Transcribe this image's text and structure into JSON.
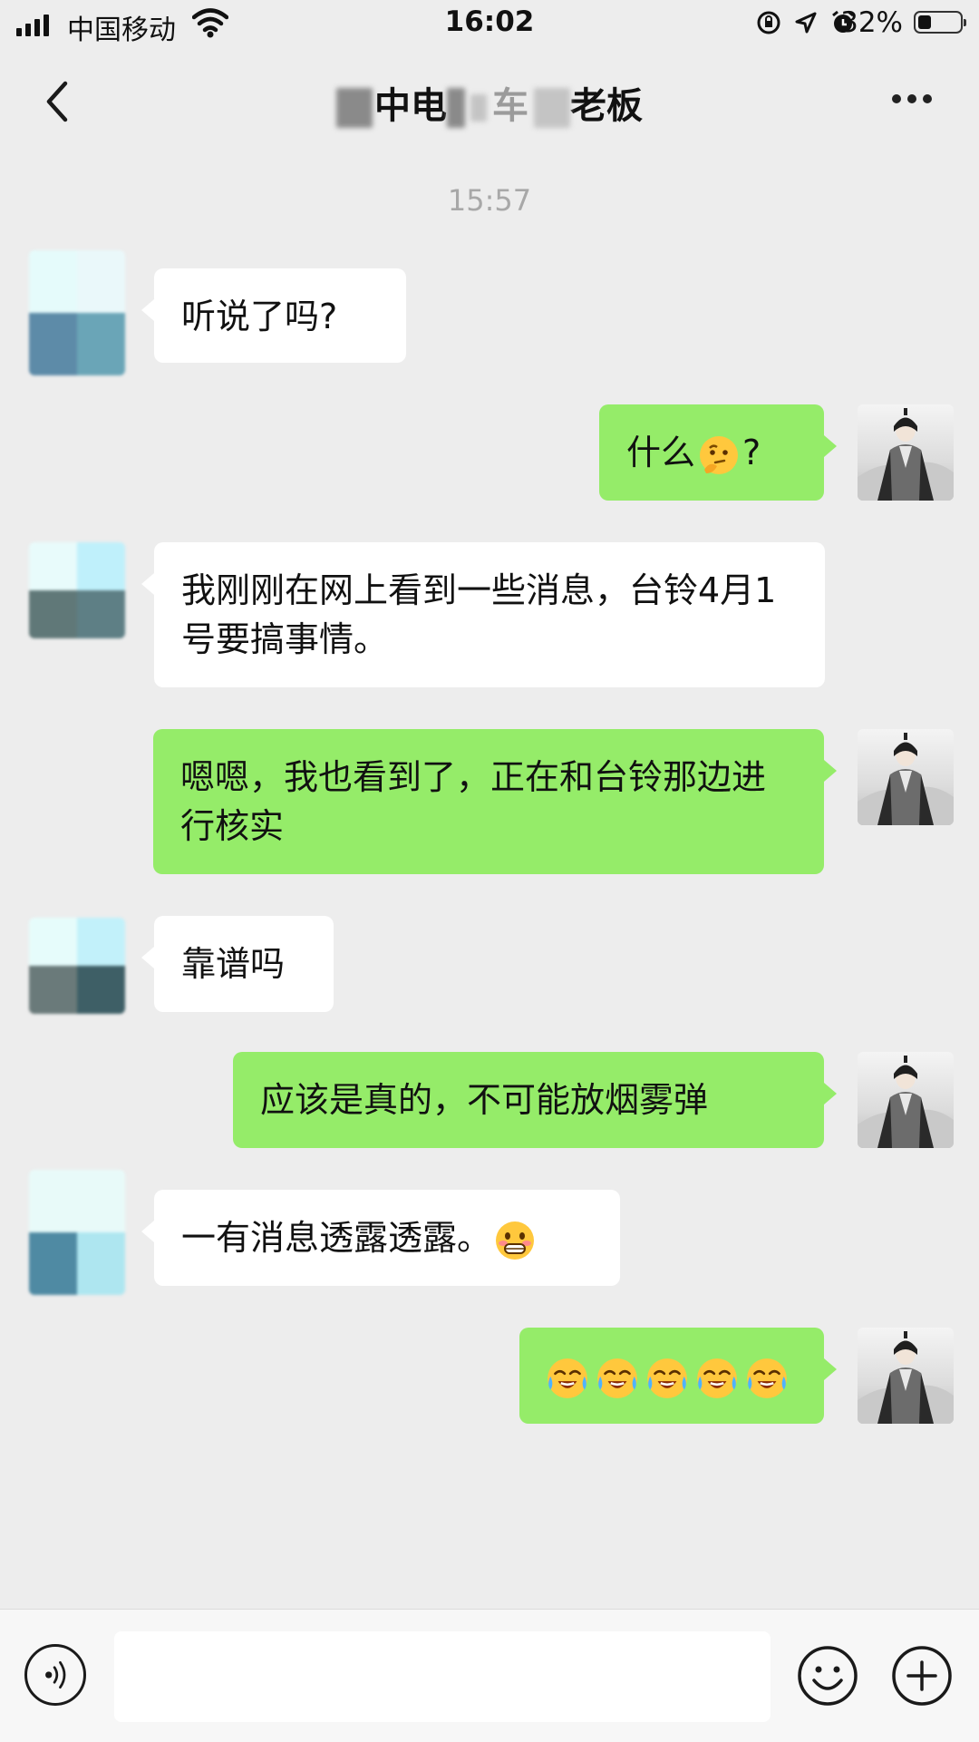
{
  "status_bar": {
    "carrier": "中国移动",
    "time": "16:02",
    "battery_percent": "32%"
  },
  "nav": {
    "title_visible_parts": [
      "中电",
      "车",
      "老板"
    ]
  },
  "chat": {
    "timestamp": "15:57",
    "messages": [
      {
        "side": "in",
        "text": "听说了吗?"
      },
      {
        "side": "out",
        "text": "什么",
        "suffix": "?",
        "emoji": "thinking-face"
      },
      {
        "side": "in",
        "text": "我刚刚在网上看到一些消息，台铃4月1号要搞事情。"
      },
      {
        "side": "out",
        "text": "嗯嗯，我也看到了，正在和台铃那边进行核实"
      },
      {
        "side": "in",
        "text": "靠谱吗"
      },
      {
        "side": "out",
        "text": "应该是真的，不可能放烟雾弹"
      },
      {
        "side": "in",
        "text": "一有消息透露透露。",
        "emoji": "grimacing-face"
      },
      {
        "side": "out",
        "emoji": "loudly-laughing-face",
        "emoji_count": 5
      }
    ]
  },
  "colors": {
    "background": "#ededed",
    "incoming_bubble": "#ffffff",
    "outgoing_bubble": "#95ec69",
    "timestamp": "#a8a8a8"
  }
}
